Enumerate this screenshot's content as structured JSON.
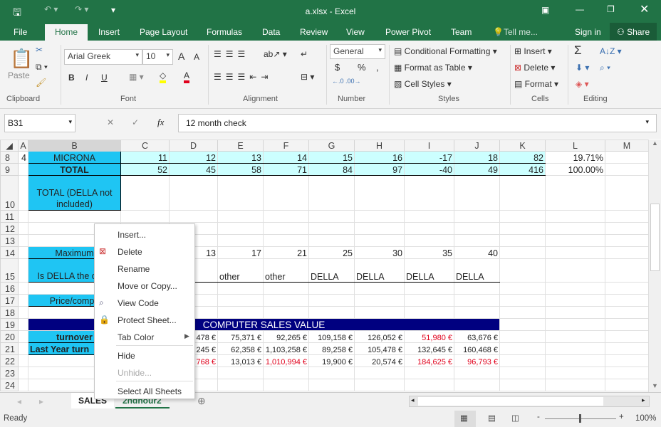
{
  "window": {
    "title": "a.xlsx - Excel"
  },
  "tabs": [
    {
      "label": "File"
    },
    {
      "label": "Home"
    },
    {
      "label": "Insert"
    },
    {
      "label": "Page Layout"
    },
    {
      "label": "Formulas"
    },
    {
      "label": "Data"
    },
    {
      "label": "Review"
    },
    {
      "label": "View"
    },
    {
      "label": "Power Pivot"
    },
    {
      "label": "Team"
    },
    {
      "label": "Tell me..."
    }
  ],
  "account": {
    "signin": "Sign in",
    "share": "Share"
  },
  "ribbon": {
    "clipboard": {
      "label": "Clipboard",
      "paste": "Paste"
    },
    "font": {
      "label": "Font",
      "name": "Arial Greek",
      "size": "10",
      "bold": "B",
      "italic": "I",
      "underline": "U",
      "grow": "A",
      "shrink": "A",
      "color_glyph": "A",
      "fill_color": "#ffff00",
      "font_color": "#e0001b"
    },
    "alignment": {
      "label": "Alignment"
    },
    "number": {
      "label": "Number",
      "format": "General",
      "currency": "$",
      "percent": "%",
      "comma": ","
    },
    "styles": {
      "label": "Styles",
      "conditional": "Conditional Formatting",
      "table": "Format as Table",
      "cell_styles": "Cell Styles"
    },
    "cells": {
      "label": "Cells",
      "insert": "Insert",
      "delete": "Delete",
      "format": "Format"
    },
    "editing": {
      "label": "Editing",
      "sum": "Σ"
    }
  },
  "formula_bar": {
    "name_box": "B31",
    "fx": "fx",
    "formula": "12 month check"
  },
  "columns": [
    "A",
    "B",
    "C",
    "D",
    "E",
    "F",
    "G",
    "H",
    "I",
    "J",
    "K",
    "L",
    "M"
  ],
  "rows": [
    {
      "n": "8",
      "cells": {
        "A": "4",
        "B": "MICRONA",
        "C": "11",
        "D": "12",
        "E": "13",
        "F": "14",
        "G": "15",
        "H": "16",
        "I": "-17",
        "J": "18",
        "K": "82",
        "L": "19.71%"
      }
    },
    {
      "n": "9",
      "cells": {
        "B": "TOTAL",
        "C": "52",
        "D": "45",
        "E": "58",
        "F": "71",
        "G": "84",
        "H": "97",
        "I": "-40",
        "J": "49",
        "K": "416",
        "L": "100.00%"
      }
    },
    {
      "n": "10",
      "cells": {
        "B": "TOTAL   (DELLA not included)"
      }
    },
    {
      "n": "11",
      "cells": {}
    },
    {
      "n": "12",
      "cells": {}
    },
    {
      "n": "13",
      "cells": {}
    },
    {
      "n": "14",
      "cells": {
        "B": "Maximum",
        "D": "13",
        "E": "17",
        "F": "21",
        "G": "25",
        "H": "30",
        "I": "35",
        "J": "40"
      }
    },
    {
      "n": "15",
      "cells": {
        "B": "Is DELLA the one?",
        "E": "other",
        "F": "other",
        "G": "DELLA",
        "H": "DELLA",
        "I": "DELLA",
        "J": "DELLA"
      }
    },
    {
      "n": "16",
      "cells": {}
    },
    {
      "n": "17",
      "cells": {
        "B": "Price/compu"
      }
    },
    {
      "n": "18",
      "cells": {}
    },
    {
      "n": "19",
      "cells": {
        "B": "COMPUTER SALES VALUE"
      }
    },
    {
      "n": "20",
      "cells": {
        "B": "turnover",
        "D": "478 €",
        "E": "75,371 €",
        "F": "92,265 €",
        "G": "109,158 €",
        "H": "126,052 €",
        "I": "51,980 €",
        "J": "63,676 €"
      }
    },
    {
      "n": "21",
      "cells": {
        "B": "Last Year turn",
        "D": "245 €",
        "E": "62,358 €",
        "F": "1,103,258 €",
        "G": "89,258 €",
        "H": "105,478 €",
        "I": "132,645 €",
        "J": "160,468 €"
      }
    },
    {
      "n": "22",
      "cells": {
        "D": "768 €",
        "E": "13,013 €",
        "F": "1,010,994 €",
        "G": "19,900 €",
        "H": "20,574 €",
        "I": "184,625 €",
        "J": "96,793 €"
      }
    },
    {
      "n": "23",
      "cells": {}
    },
    {
      "n": "24",
      "cells": {}
    }
  ],
  "context_menu": {
    "items": [
      {
        "label": "Insert..."
      },
      {
        "label": "Delete"
      },
      {
        "label": "Rename"
      },
      {
        "label": "Move or Copy..."
      },
      {
        "label": "View Code"
      },
      {
        "label": "Protect Sheet..."
      },
      {
        "label": "Tab Color"
      },
      {
        "label": "Hide"
      },
      {
        "label": "Unhide...",
        "disabled": true
      },
      {
        "label": "Select All Sheets"
      }
    ]
  },
  "sheets": [
    {
      "label": "SALES",
      "active": true
    },
    {
      "label": "2ndhour2"
    }
  ],
  "status": {
    "text": "Ready",
    "zoom": "100%"
  },
  "colors": {
    "excel_green": "#217346",
    "cyan": "#1fc5f3",
    "light_cyan": "#ccffff",
    "navy": "#000080",
    "negative": "#e0001b"
  }
}
